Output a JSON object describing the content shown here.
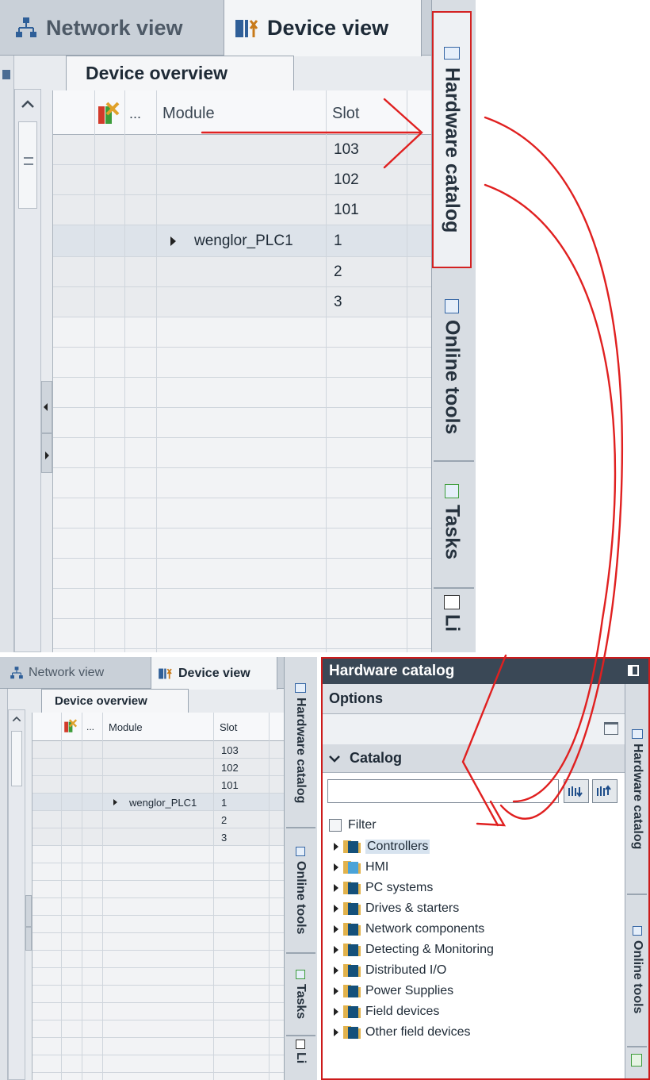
{
  "window": {
    "tabs": {
      "network_view": "Network view",
      "device_view": "Device view"
    },
    "subtab": "Device overview",
    "columns": {
      "module": "Module",
      "slot": "Slot",
      "ellipsis": "..."
    },
    "rows": [
      {
        "module": "",
        "slot": "103"
      },
      {
        "module": "",
        "slot": "102"
      },
      {
        "module": "",
        "slot": "101"
      },
      {
        "module": "wenglor_PLC1",
        "slot": "1"
      },
      {
        "module": "",
        "slot": "2"
      },
      {
        "module": "",
        "slot": "3"
      }
    ],
    "side_tabs": [
      "Hardware catalog",
      "Online tools",
      "Tasks",
      "Li"
    ]
  },
  "catalog": {
    "title": "Hardware catalog",
    "options_label": "Options",
    "catalog_label": "Catalog",
    "search_value": "",
    "filter_label": "Filter",
    "items": [
      {
        "label": "Controllers",
        "icon": "controllers-folder-icon"
      },
      {
        "label": "HMI",
        "icon": "hmi-folder-icon"
      },
      {
        "label": "PC systems",
        "icon": "folder-icon"
      },
      {
        "label": "Drives & starters",
        "icon": "folder-icon"
      },
      {
        "label": "Network components",
        "icon": "folder-icon"
      },
      {
        "label": "Detecting & Monitoring",
        "icon": "folder-icon"
      },
      {
        "label": "Distributed I/O",
        "icon": "folder-icon"
      },
      {
        "label": "Power Supplies",
        "icon": "folder-icon"
      },
      {
        "label": "Field devices",
        "icon": "folder-icon"
      },
      {
        "label": "Other field devices",
        "icon": "folder-icon"
      }
    ],
    "side_tabs": [
      "Hardware catalog",
      "Online tools"
    ]
  },
  "colors": {
    "highlight": "#d32222",
    "title_bar": "#3a4856",
    "folder": "#e1b24c"
  }
}
